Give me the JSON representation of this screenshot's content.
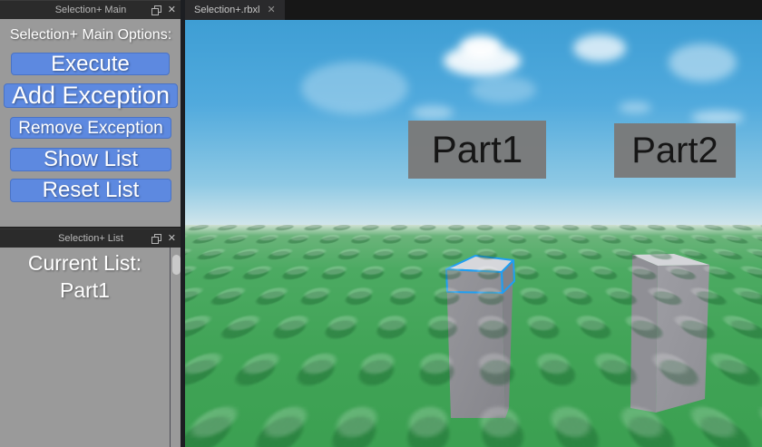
{
  "colors": {
    "button_blue": "#5d89e0",
    "button_blue_border": "#4a73c5",
    "selection_blue": "#1f9ff2",
    "panel_gray": "#9a9a9a",
    "titlebar_dark": "#2b2b2b",
    "ground_green": "#41a457"
  },
  "icons": {
    "close_glyph": "✕",
    "tab_close_glyph": "✕"
  },
  "panels": {
    "main": {
      "title": "Selection+ Main",
      "heading": "Selection+ Main Options:",
      "buttons": [
        {
          "label": "Execute"
        },
        {
          "label": "Add Exception"
        },
        {
          "label": "Remove Exception"
        },
        {
          "label": "Show List"
        },
        {
          "label": "Reset List"
        }
      ]
    },
    "list": {
      "title": "Selection+ List",
      "heading": "Current List:",
      "items": [
        "Part1"
      ]
    }
  },
  "tabbar": {
    "tabs": [
      {
        "label": "Selection+.rbxl",
        "active": true
      }
    ]
  },
  "viewport": {
    "billboards": [
      {
        "label": "Part1"
      },
      {
        "label": "Part2"
      }
    ],
    "selected_part": "Part1"
  }
}
